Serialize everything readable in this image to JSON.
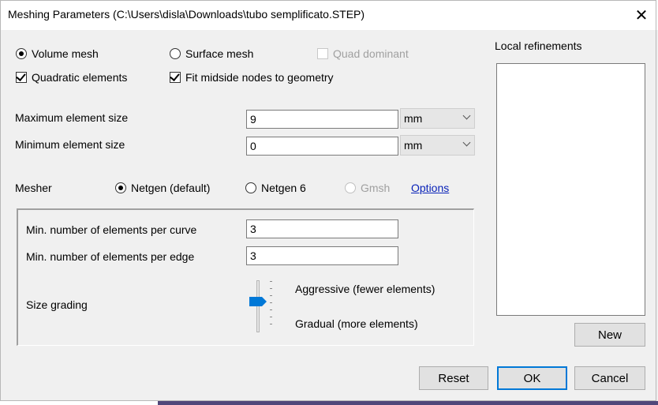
{
  "window": {
    "title": "Meshing Parameters (C:\\Users\\disla\\Downloads\\tubo semplificato.STEP)",
    "close_glyph": "✕"
  },
  "mesh_type": {
    "volume_label": "Volume mesh",
    "surface_label": "Surface mesh",
    "quad_label": "Quad dominant",
    "selected": "volume"
  },
  "options": {
    "quadratic_label": "Quadratic elements",
    "quadratic_checked": true,
    "fit_midside_label": "Fit midside nodes to geometry",
    "fit_midside_checked": true,
    "quad_checked": false
  },
  "sizes": {
    "max_label": "Maximum element size",
    "max_value": "9",
    "max_unit": "mm",
    "min_label": "Minimum element size",
    "min_value": "0",
    "min_unit": "mm"
  },
  "mesher": {
    "label": "Mesher",
    "netgen_default": "Netgen (default)",
    "netgen6": "Netgen 6",
    "gmsh": "Gmsh",
    "options_link": "Options",
    "selected": "netgen_default"
  },
  "netgen_group": {
    "per_curve_label": "Min. number of elements per curve",
    "per_curve_value": "3",
    "per_edge_label": "Min. number of elements per edge",
    "per_edge_value": "3",
    "grading_label": "Size grading",
    "aggressive_label": "Aggressive (fewer elements)",
    "gradual_label": "Gradual (more elements)",
    "grading_level": 0.5
  },
  "local_refinements": {
    "label": "Local refinements",
    "new_button": "New"
  },
  "footer": {
    "reset": "Reset",
    "ok": "OK",
    "cancel": "Cancel"
  },
  "colors": {
    "accent": "#0078d7",
    "link": "#0a23b8",
    "disabled_text": "#a0a0a0"
  }
}
